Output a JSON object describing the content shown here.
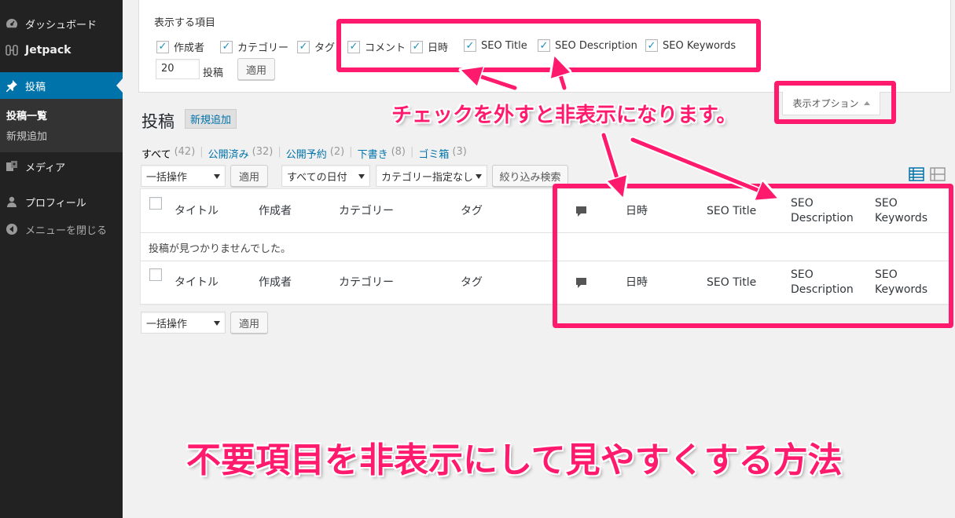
{
  "colors": {
    "sidebar_bg": "#222222",
    "active_menu": "#0073aa",
    "link": "#0073aa",
    "highlight": "#ff1a6d",
    "checkbox_tick": "#1e8cbe"
  },
  "sidebar": {
    "items": [
      {
        "label": "ダッシュボード",
        "icon": "dashboard-icon"
      },
      {
        "label": "Jetpack",
        "icon": "jetpack-icon"
      },
      {
        "label": "投稿",
        "icon": "pin-icon",
        "active": true
      },
      {
        "label": "メディア",
        "icon": "media-icon"
      },
      {
        "label": "プロフィール",
        "icon": "user-icon"
      },
      {
        "label": "メニューを閉じる",
        "icon": "collapse-icon"
      }
    ],
    "submenu": [
      {
        "label": "投稿一覧",
        "current": true
      },
      {
        "label": "新規追加"
      }
    ]
  },
  "screen_options": {
    "title": "表示する項目",
    "columns": [
      {
        "label": "作成者",
        "checked": true
      },
      {
        "label": "カテゴリー",
        "checked": true
      },
      {
        "label": "タグ",
        "checked": true
      },
      {
        "label": "コメント",
        "checked": true
      },
      {
        "label": "日時",
        "checked": true
      },
      {
        "label": "SEO Title",
        "checked": true
      },
      {
        "label": "SEO Description",
        "checked": true
      },
      {
        "label": "SEO Keywords",
        "checked": true
      }
    ],
    "per_page_value": "20",
    "per_page_label": "投稿",
    "apply_label": "適用",
    "tab_label": "表示オプション"
  },
  "header": {
    "title": "投稿",
    "add_new_label": "新規追加"
  },
  "status_links": [
    {
      "label": "すべて",
      "count": "(42)",
      "current": true
    },
    {
      "label": "公開済み",
      "count": "(32)"
    },
    {
      "label": "公開予約",
      "count": "(2)"
    },
    {
      "label": "下書き",
      "count": "(8)"
    },
    {
      "label": "ゴミ箱",
      "count": "(3)"
    }
  ],
  "filters": {
    "bulk_action": "一括操作",
    "apply_label": "適用",
    "date_filter": "すべての日付",
    "category_filter": "カテゴリー指定なし",
    "filter_button": "絞り込み検索"
  },
  "table": {
    "columns": [
      "タイトル",
      "作成者",
      "カテゴリー",
      "タグ",
      "日時",
      "SEO Title",
      "SEO Description",
      "SEO Keywords"
    ],
    "comment_icon": "comment-bubble-icon",
    "empty_message": "投稿が見つかりませんでした。"
  },
  "bottom_actions": {
    "bulk_action": "一括操作",
    "apply_label": "適用"
  },
  "annotations": {
    "callout": "チェックを外すと非表示になります。",
    "banner": "不要項目を非表示にして見やすくする方法"
  }
}
